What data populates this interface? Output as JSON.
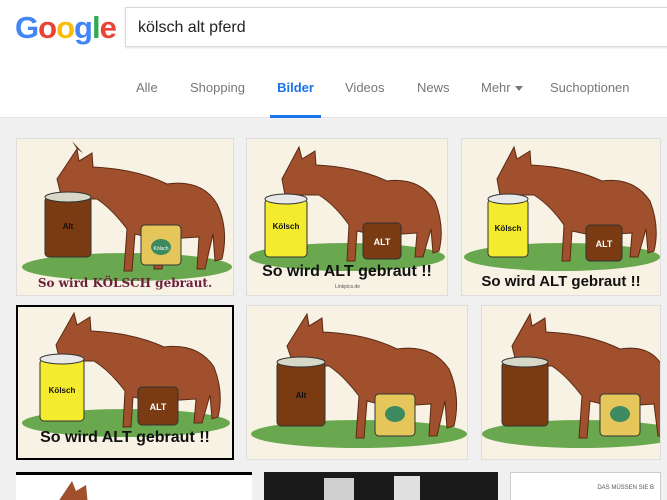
{
  "search": {
    "query": "kölsch alt pferd"
  },
  "logo": {
    "letters": [
      "G",
      "o",
      "o",
      "g",
      "l",
      "e"
    ],
    "colors": [
      "#4285F4",
      "#EA4335",
      "#FBBC05",
      "#4285F4",
      "#34A853",
      "#EA4335"
    ]
  },
  "tabs": [
    {
      "label": "Alle"
    },
    {
      "label": "Shopping"
    },
    {
      "label": "Bilder"
    },
    {
      "label": "Videos"
    },
    {
      "label": "News"
    },
    {
      "label": "Mehr"
    },
    {
      "label": "Suchoptionen"
    }
  ],
  "active_tab": "Bilder",
  "results": [
    {
      "caption": "So wird KÖLSCH gebraut.",
      "cup_label": "Alt",
      "bucket_label": "Kölsch",
      "watermark": ""
    },
    {
      "caption": "So wird ALT gebraut !!",
      "cup_label": "Kölsch",
      "bucket_label": "ALT",
      "watermark": "Linkpics.de"
    },
    {
      "caption": "So wird ALT gebraut !!",
      "cup_label": "Kölsch",
      "bucket_label": "ALT",
      "watermark": ""
    },
    {
      "caption": "So wird ALT gebraut !!",
      "cup_label": "Kölsch",
      "bucket_label": "ALT",
      "watermark": ""
    },
    {
      "caption": "",
      "cup_label": "Alt",
      "bucket_label": "",
      "watermark": ""
    },
    {
      "caption": "",
      "cup_label": "",
      "bucket_label": "",
      "watermark": ""
    }
  ],
  "partial_row": {
    "text": "DAS MÜSSEN SIE B"
  },
  "colors": {
    "accent": "#1a73e8",
    "horse": "#a0502d",
    "cup_yellow": "#f4ea2e",
    "cup_brown": "#7a3a12",
    "grass": "#6aa84f"
  }
}
